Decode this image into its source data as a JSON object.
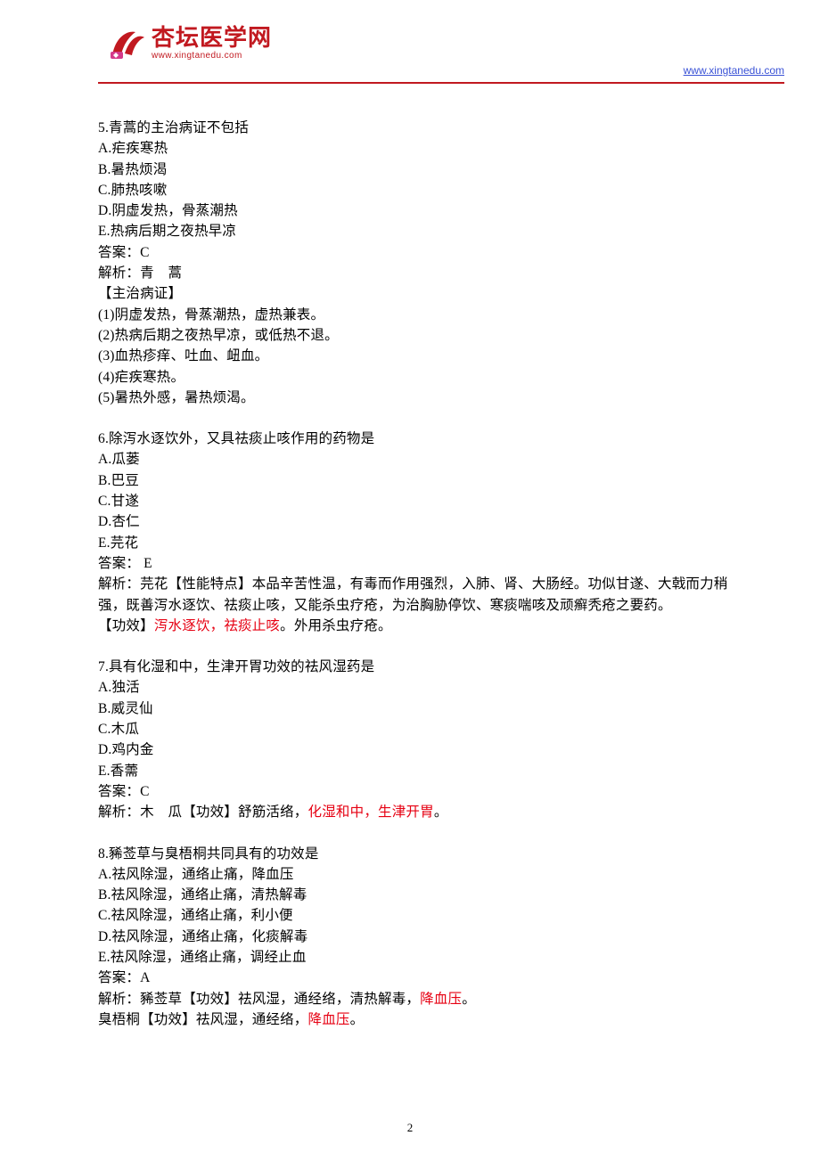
{
  "header": {
    "logo_chinese": "杏坛医学网",
    "logo_url": "www.xingtanedu.com",
    "header_link": "www.xingtanedu.com"
  },
  "page_number": "2",
  "q5": {
    "stem": "5.青蒿的主治病证不包括",
    "a": "A.疟疾寒热",
    "b": "B.暑热烦渴",
    "c": "C.肺热咳嗽",
    "d": "D.阴虚发热，骨蒸潮热",
    "e": "E.热病后期之夜热早凉",
    "ans": "答案：C",
    "jx1": "解析：青　蒿",
    "jx2": "【主治病证】",
    "jx3": "(1)阴虚发热，骨蒸潮热，虚热兼表。",
    "jx4": "(2)热病后期之夜热早凉，或低热不退。",
    "jx5": "(3)血热疹痒、吐血、衄血。",
    "jx6": "(4)疟疾寒热。",
    "jx7": "(5)暑热外感，暑热烦渴。"
  },
  "q6": {
    "stem": "6.除泻水逐饮外，又具祛痰止咳作用的药物是",
    "a": "A.瓜蒌",
    "b": "B.巴豆",
    "c": "C.甘遂",
    "d": "D.杏仁",
    "e": "E.芫花",
    "ans": "答案： E",
    "jx1": "解析：芫花【性能特点】本品辛苦性温，有毒而作用强烈，入肺、肾、大肠经。功似甘遂、大戟而力稍强，既善泻水逐饮、祛痰止咳，又能杀虫疗疮，为治胸胁停饮、寒痰喘咳及顽癣秃疮之要药。",
    "jx2a": "【功效】",
    "jx2b": "泻水逐饮，祛痰止咳",
    "jx2c": "。外用杀虫疗疮。"
  },
  "q7": {
    "stem": "7.具有化湿和中，生津开胃功效的祛风湿药是",
    "a": "A.独活",
    "b": "B.威灵仙",
    "c": "C.木瓜",
    "d": "D.鸡内金",
    "e": "E.香薷",
    "ans": "答案：C",
    "jxa": "解析：木　瓜【功效】舒筋活络，",
    "jxb": "化湿和中，生津开胃",
    "jxc": "。"
  },
  "q8": {
    "stem": "8.豨莶草与臭梧桐共同具有的功效是",
    "a": "A.祛风除湿，通络止痛，降血压",
    "b": "B.祛风除湿，通络止痛，清热解毒",
    "c": "C.祛风除湿，通络止痛，利小便",
    "d": "D.祛风除湿，通络止痛，化痰解毒",
    "e": "E.祛风除湿，通络止痛，调经止血",
    "ans": "答案：A",
    "jx1a": "解析：豨莶草【功效】祛风湿，通经络，清热解毒，",
    "jx1b": "降血压",
    "jx1c": "。",
    "jx2a": "臭梧桐【功效】祛风湿，通经络，",
    "jx2b": "降血压",
    "jx2c": "。"
  }
}
